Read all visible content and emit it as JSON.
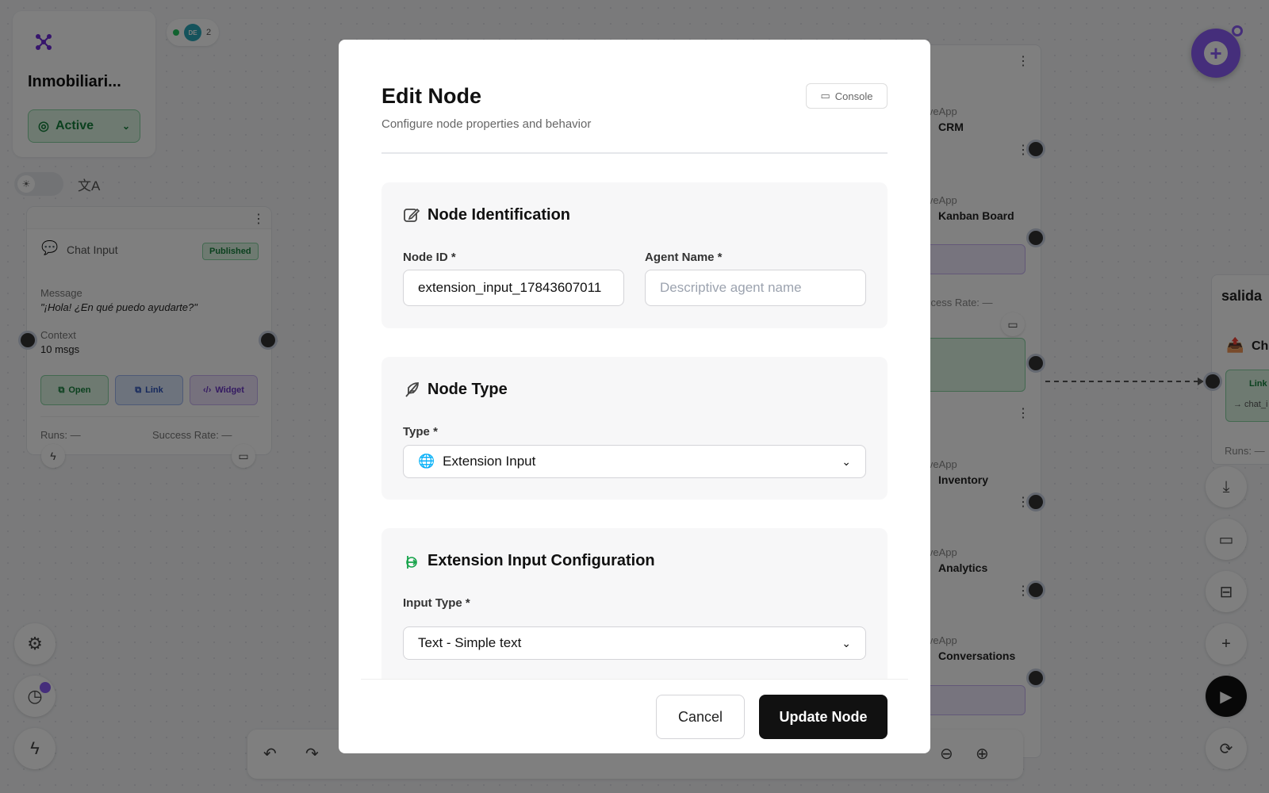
{
  "workspace": {
    "title": "Inmobiliari...",
    "status_label": "Active",
    "active_users_initials": "DE",
    "active_users_count": "2"
  },
  "chat_node": {
    "label": "Chat Input",
    "badge": "Published",
    "message_label": "Message",
    "message_value": "\"¡Hola! ¿En qué puedo ayudarte?\"",
    "context_label": "Context",
    "context_value": "10 msgs",
    "open_label": "Open",
    "link_label": "Link",
    "widget_label": "Widget",
    "runs_label": "Runs: —",
    "success_label": "Success Rate: —"
  },
  "right_nodes": [
    {
      "app": "iveApp",
      "name": "CRM"
    },
    {
      "app": "iveApp",
      "name": "Kanban Board"
    },
    {
      "app": "iveApp",
      "name": "Inventory"
    },
    {
      "app": "iveApp",
      "name": "Analytics"
    },
    {
      "app": "iveApp",
      "name": "Conversations"
    }
  ],
  "right_success": "ccess Rate: —",
  "salida": {
    "title": "salida",
    "name_partial": "Ch",
    "link_partial": "Link",
    "chat_partial": "→ chat_i",
    "runs": "Runs: —"
  },
  "modal": {
    "title": "Edit Node",
    "subtitle": "Configure node properties and behavior",
    "console_label": "Console",
    "sections": {
      "identification": {
        "title": "Node Identification",
        "node_id_label": "Node ID *",
        "node_id_value": "extension_input_17843607011",
        "agent_name_label": "Agent Name *",
        "agent_name_placeholder": "Descriptive agent name"
      },
      "type": {
        "title": "Node Type",
        "type_label": "Type *",
        "type_value": "Extension Input"
      },
      "config": {
        "title": "Extension Input Configuration",
        "input_type_label": "Input Type *",
        "input_type_value": "Text - Simple text"
      }
    },
    "cancel_label": "Cancel",
    "update_label": "Update Node"
  },
  "colors": {
    "accent_purple": "#8b5cf6",
    "active_green": "#16803c",
    "primary_dark": "#111111"
  }
}
